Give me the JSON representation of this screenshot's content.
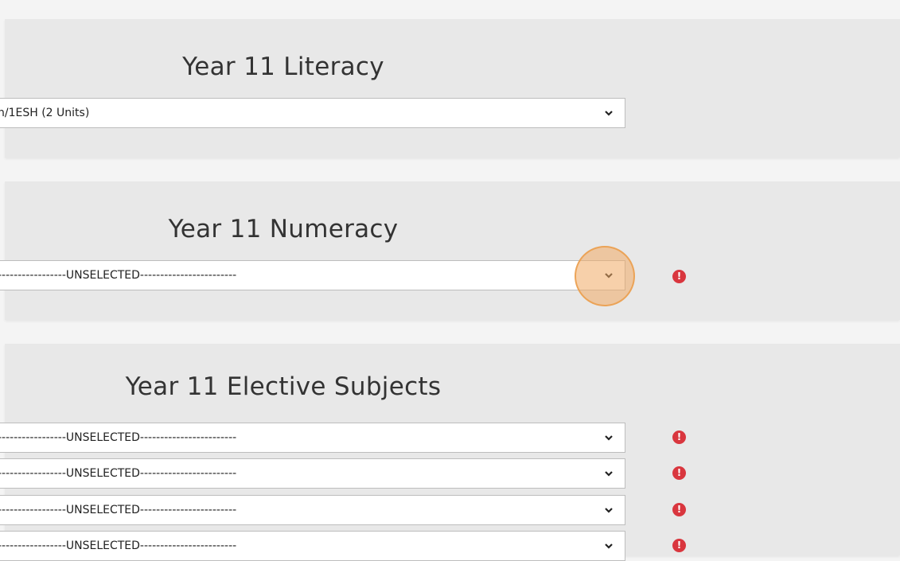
{
  "sections": {
    "literacy": {
      "title": "Year 11 Literacy",
      "select_value": "n/1ESH (2 Units)"
    },
    "numeracy": {
      "title": "Year 11 Numeracy",
      "select_value": "-----------------UNSELECTED------------------------"
    },
    "elective": {
      "title": "Year 11 Elective Subjects",
      "selects": [
        "-----------------UNSELECTED------------------------",
        "-----------------UNSELECTED------------------------",
        "-----------------UNSELECTED------------------------",
        "-----------------UNSELECTED------------------------"
      ]
    }
  },
  "icons": {
    "dropdown": "chevron-down-icon",
    "warning": "exclamation-circle-icon"
  },
  "warning_glyph": "!",
  "colors": {
    "warning": "#d9363e",
    "highlight": "#f0a864"
  }
}
